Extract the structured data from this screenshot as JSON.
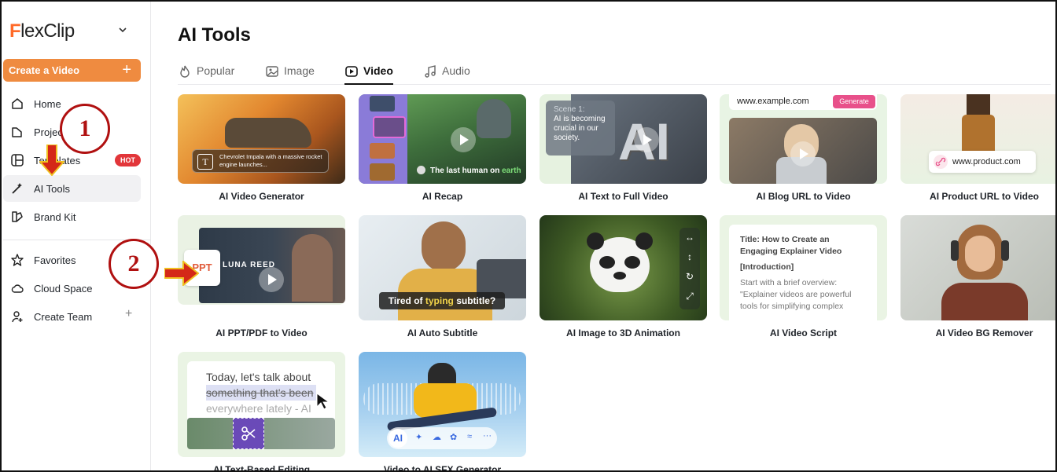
{
  "brand": {
    "logo_accent": "F",
    "logo_rest": "lexClip"
  },
  "sidebar": {
    "create_label": "Create a Video",
    "create_plus": "+",
    "items": [
      {
        "label": "Home",
        "icon": "home-icon"
      },
      {
        "label": "Projects",
        "icon": "folder-icon"
      },
      {
        "label": "Templates",
        "icon": "templates-icon",
        "badge": "HOT"
      },
      {
        "label": "AI Tools",
        "icon": "magic-wand-icon",
        "active": true
      },
      {
        "label": "Brand Kit",
        "icon": "brand-kit-icon"
      },
      {
        "label": "Favorites",
        "icon": "star-icon"
      },
      {
        "label": "Cloud Space",
        "icon": "cloud-icon"
      },
      {
        "label": "Create Team",
        "icon": "add-person-icon",
        "action": "+"
      }
    ]
  },
  "main": {
    "title": "AI Tools",
    "tabs": [
      {
        "label": "Popular",
        "icon": "fire-icon"
      },
      {
        "label": "Image",
        "icon": "image-icon"
      },
      {
        "label": "Video",
        "icon": "video-icon",
        "active": true
      },
      {
        "label": "Audio",
        "icon": "music-note-icon"
      }
    ],
    "tools": [
      {
        "label": "AI Video Generator",
        "caption": "Chevrolet Impala with a massive rocket engine launches..."
      },
      {
        "label": "AI Recap",
        "caption_a": "The last human on ",
        "caption_b": "earth"
      },
      {
        "label": "AI Text to Full Video",
        "caption": "Scene 1:",
        "caption2": "AI is becoming crucial in our society."
      },
      {
        "label": "AI Blog URL to Video",
        "url": "www.example.com",
        "button": "Generate"
      },
      {
        "label": "AI Product URL to Video",
        "url": "www.product.com"
      },
      {
        "label": "AI PPT/PDF to Video",
        "caption": "LUNA REED",
        "badge": "PPT"
      },
      {
        "label": "AI Auto Subtitle",
        "caption_a": "Tired of ",
        "caption_b": "typing",
        "caption_c": " subtitle?"
      },
      {
        "label": "AI Image to 3D Animation"
      },
      {
        "label": "AI Video Script",
        "script_title": "Title: How to Create an Engaging Explainer Video",
        "script_intro": "[Introduction]",
        "script_body": "Start with a brief overview: \"Explainer videos are powerful tools for simplifying complex"
      },
      {
        "label": "AI Video BG Remover"
      },
      {
        "label": "AI Text-Based Editing",
        "line1": "Today, let's talk about",
        "line2": "something that's been",
        "line3": "everywhere lately - AI"
      },
      {
        "label": "Video to AI SFX Generator",
        "chip": "AI"
      }
    ]
  },
  "annotations": {
    "step1": "1",
    "step2": "2"
  },
  "colors": {
    "accent": "#ef8b40",
    "hot": "#e2363a",
    "annotation": "#b01010",
    "generate": "#e8508a"
  }
}
